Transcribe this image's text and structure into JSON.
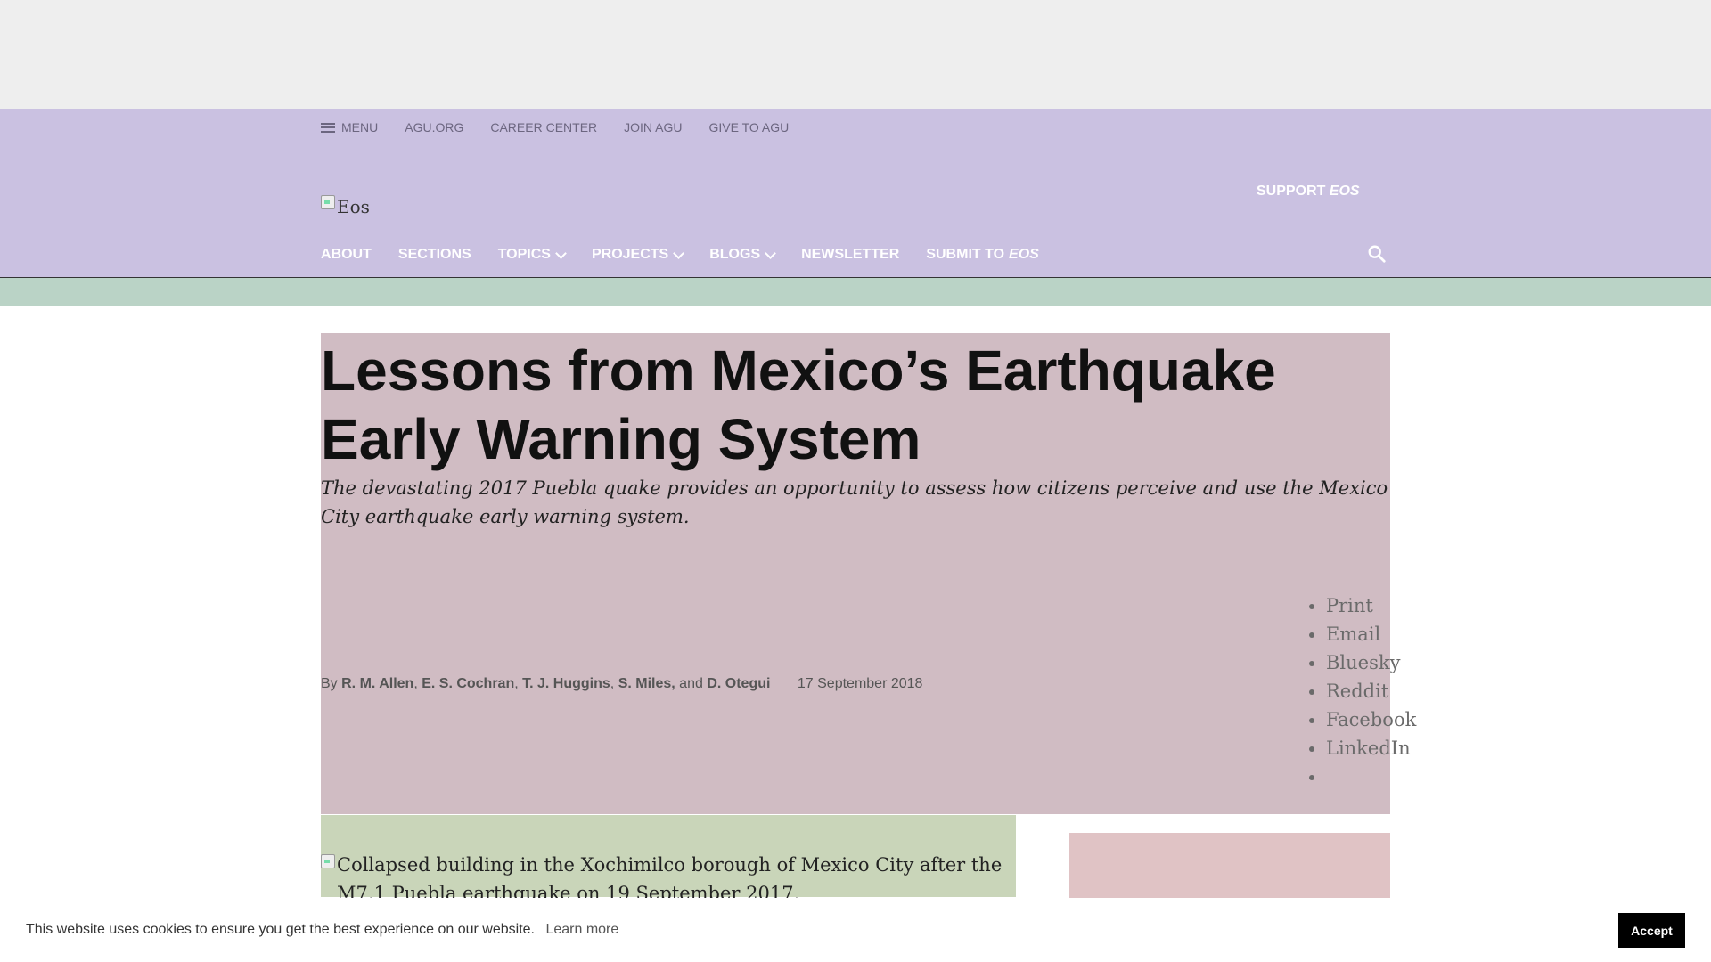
{
  "utility_nav": {
    "menu_label": "MENU",
    "links": [
      "AGU.ORG",
      "CAREER CENTER",
      "JOIN AGU",
      "GIVE TO AGU"
    ]
  },
  "header": {
    "logo_alt": "Eos",
    "support_label": "SUPPORT",
    "support_em": "EOS"
  },
  "main_nav": {
    "about": "ABOUT",
    "sections": "SECTIONS",
    "topics": "TOPICS",
    "projects": "PROJECTS",
    "blogs": "BLOGS",
    "newsletter": "NEWSLETTER",
    "submit_label": "SUBMIT TO",
    "submit_em": "EOS"
  },
  "article": {
    "title": "Lessons from Mexico’s Earthquake Early Warning System",
    "subtitle": "The devastating 2017 Puebla quake provides an opportunity to assess how citizens perceive and use the Mexico City earthquake early warning system.",
    "by": "By",
    "authors": [
      "R. M. Allen",
      "E. S. Cochran",
      "T. J. Huggins",
      "S. Miles,"
    ],
    "and": "and",
    "last_author": "D. Otegui",
    "date": "17 September 2018",
    "share_links": [
      "Print",
      "Email",
      "Bluesky",
      "Reddit",
      "Facebook",
      "LinkedIn",
      ""
    ],
    "figure_alt": "Collapsed building in the Xochimilco borough of Mexico City after the M7.1 Puebla earthquake on 19 September 2017."
  },
  "cookie": {
    "message": "This website uses cookies to ensure you get the best experience on our website.",
    "learn_more": "Learn more",
    "accept": "Accept"
  },
  "colors": {
    "header_bg": "#cac1e1",
    "band_green": "#bad3c6",
    "article_head_bg": "#d0bcc3",
    "figure_bg": "#c9d5b9",
    "sidebar_bg": "#e0c3c5"
  },
  "icons": [
    "hamburger-icon",
    "chevron-down-icon",
    "search-icon",
    "broken-image-icon"
  ]
}
